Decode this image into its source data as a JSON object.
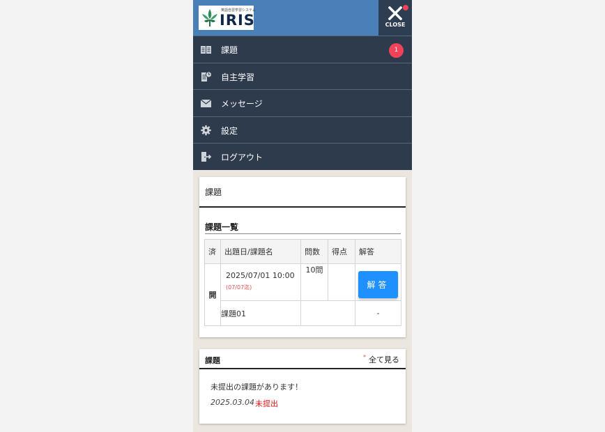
{
  "header": {
    "logo_tagline": "英語自習学習システム",
    "logo_word": "IRIS",
    "close_label": "CLOSE"
  },
  "menu": {
    "items": [
      {
        "label": "課題",
        "icon": "book-icon",
        "badge": "1"
      },
      {
        "label": "自主学習",
        "icon": "study-icon"
      },
      {
        "label": "メッセージ",
        "icon": "mail-icon"
      },
      {
        "label": "設定",
        "icon": "gear-icon"
      },
      {
        "label": "ログアウト",
        "icon": "logout-icon"
      }
    ]
  },
  "assignments_card": {
    "title": "課題",
    "list_heading": "課題一覧",
    "columns": [
      "済",
      "出題日/課題名",
      "問数",
      "得点",
      "解答"
    ],
    "rows": [
      {
        "done": "開",
        "date": "2025/07/01 10:00",
        "due": "(07/07迄)",
        "question_count": "10問",
        "score": "",
        "answer_label": "解答",
        "name": "課題01",
        "answer_placeholder": "-"
      }
    ]
  },
  "news_card": {
    "title": "課題",
    "see_all_marker": "*",
    "see_all": "全て見る",
    "notice": "未提出の課題があります！",
    "date": "2025.03.04",
    "status": "未提出"
  },
  "colors": {
    "header_blue": "#4a80b8",
    "menu_navy": "#2e3b4d",
    "badge_red": "#f0435a",
    "answer_blue": "#1e90ff",
    "warning_red": "#e01818"
  }
}
